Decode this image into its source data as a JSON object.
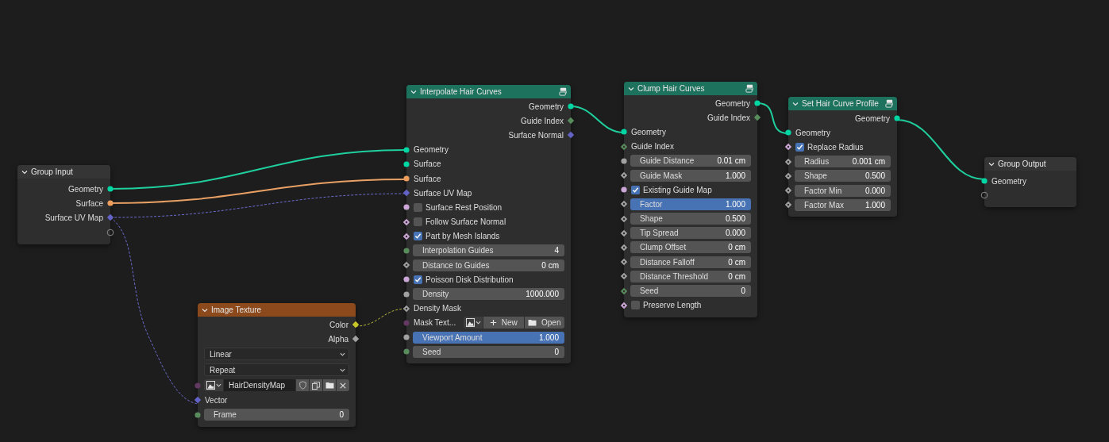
{
  "nodes": [
    {
      "title": "Group Input",
      "kind": "group",
      "rows": [
        {
          "kind": "output",
          "label": "Geometry",
          "socket": {
            "kind": "circle",
            "color": "#00d6a3"
          }
        },
        {
          "kind": "output",
          "label": "Surface",
          "socket": {
            "kind": "circle",
            "color": "#ed9e5c"
          }
        },
        {
          "kind": "output",
          "label": "Surface UV Map",
          "socket": {
            "kind": "diamond",
            "color": "#6363c7"
          }
        },
        {
          "kind": "output",
          "socket": {
            "kind": "empty"
          }
        }
      ]
    },
    {
      "title": "Image Texture",
      "kind": "texture",
      "rows": [
        {
          "kind": "output",
          "label": "Color",
          "socket": {
            "kind": "diamond",
            "color": "#c7c729"
          }
        },
        {
          "kind": "output",
          "label": "Alpha",
          "socket": {
            "kind": "diamond",
            "color": "#a1a1a1"
          }
        },
        {
          "kind": "dropdown",
          "value": "Linear"
        },
        {
          "kind": "dropdown",
          "value": "Repeat"
        },
        {
          "kind": "image_picker",
          "value": "HairDensityMap",
          "socket": {
            "kind": "circle",
            "color": "#633863"
          }
        },
        {
          "kind": "input",
          "label": "Vector",
          "socket": {
            "kind": "diamond",
            "color": "#6363c7"
          }
        },
        {
          "kind": "field",
          "label": "Frame",
          "value": "0",
          "selected": false,
          "socket": {
            "kind": "circle",
            "color": "#598c5c"
          }
        }
      ]
    },
    {
      "title": "Interpolate Hair Curves",
      "kind": "geometry",
      "rows": [
        {
          "kind": "output",
          "label": "Geometry",
          "socket": {
            "kind": "circle",
            "color": "#00d6a3"
          }
        },
        {
          "kind": "output",
          "label": "Guide Index",
          "socket": {
            "kind": "diamond",
            "color": "#598c5c"
          }
        },
        {
          "kind": "output",
          "label": "Surface Normal",
          "socket": {
            "kind": "diamond",
            "color": "#6363c7"
          }
        },
        {
          "kind": "input",
          "label": "Geometry",
          "socket": {
            "kind": "circle",
            "color": "#00d6a3"
          }
        },
        {
          "kind": "input",
          "label": "Surface",
          "socket": {
            "kind": "circle",
            "color": "#00d6a3"
          }
        },
        {
          "kind": "input",
          "label": "Surface",
          "socket": {
            "kind": "circle",
            "color": "#ed9e5c"
          }
        },
        {
          "kind": "input",
          "label": "Surface UV Map",
          "socket": {
            "kind": "diamond",
            "color": "#6363c7"
          }
        },
        {
          "kind": "checkbox",
          "label": "Surface Rest Position",
          "checked": false,
          "socket": {
            "kind": "circle",
            "color": "#cca6d6"
          }
        },
        {
          "kind": "checkbox",
          "label": "Follow Surface Normal",
          "checked": false,
          "socket": {
            "kind": "diamond_dot",
            "color": "#cca6d6"
          }
        },
        {
          "kind": "checkbox",
          "label": "Part by Mesh Islands",
          "checked": true,
          "socket": {
            "kind": "diamond_dot",
            "color": "#cca6d6"
          }
        },
        {
          "kind": "field",
          "label": "Interpolation Guides",
          "value": "4",
          "selected": false,
          "socket": {
            "kind": "circle",
            "color": "#598c5c"
          }
        },
        {
          "kind": "field",
          "label": "Distance to Guides",
          "value": "0 cm",
          "selected": false,
          "socket": {
            "kind": "diamond_dot",
            "color": "#a1a1a1"
          }
        },
        {
          "kind": "checkbox",
          "label": "Poisson Disk Distribution",
          "checked": true,
          "socket": {
            "kind": "circle",
            "color": "#cca6d6"
          }
        },
        {
          "kind": "field",
          "label": "Density",
          "value": "1000.000",
          "selected": false,
          "socket": {
            "kind": "circle",
            "color": "#a1a1a1"
          }
        },
        {
          "kind": "input",
          "label": "Density Mask",
          "socket": {
            "kind": "diamond_dot",
            "color": "#a1a1a1"
          }
        },
        {
          "kind": "texture_picker",
          "label": "Mask Text...",
          "buttons": [
            "New",
            "Open"
          ],
          "socket": {
            "kind": "circle",
            "color": "#633863"
          }
        },
        {
          "kind": "field",
          "label": "Viewport Amount",
          "value": "1.000",
          "selected": true,
          "socket": {
            "kind": "circle",
            "color": "#a1a1a1"
          }
        },
        {
          "kind": "field",
          "label": "Seed",
          "value": "0",
          "selected": false,
          "socket": {
            "kind": "circle",
            "color": "#598c5c"
          }
        }
      ]
    },
    {
      "title": "Clump Hair Curves",
      "kind": "geometry",
      "rows": [
        {
          "kind": "output",
          "label": "Geometry",
          "socket": {
            "kind": "circle",
            "color": "#00d6a3"
          }
        },
        {
          "kind": "output",
          "label": "Guide Index",
          "socket": {
            "kind": "diamond",
            "color": "#598c5c"
          }
        },
        {
          "kind": "input",
          "label": "Geometry",
          "socket": {
            "kind": "circle",
            "color": "#00d6a3"
          }
        },
        {
          "kind": "input",
          "label": "Guide Index",
          "socket": {
            "kind": "diamond_dot",
            "color": "#598c5c"
          }
        },
        {
          "kind": "field",
          "label": "Guide Distance",
          "value": "0.01 cm",
          "selected": false,
          "socket": {
            "kind": "circle",
            "color": "#a1a1a1"
          }
        },
        {
          "kind": "field",
          "label": "Guide Mask",
          "value": "1.000",
          "selected": false,
          "socket": {
            "kind": "diamond_dot",
            "color": "#a1a1a1"
          }
        },
        {
          "kind": "checkbox",
          "label": "Existing Guide Map",
          "checked": true,
          "socket": {
            "kind": "circle",
            "color": "#cca6d6"
          }
        },
        {
          "kind": "field",
          "label": "Factor",
          "value": "1.000",
          "selected": true,
          "socket": {
            "kind": "diamond_dot",
            "color": "#a1a1a1"
          }
        },
        {
          "kind": "field",
          "label": "Shape",
          "value": "0.500",
          "selected": false,
          "socket": {
            "kind": "diamond_dot",
            "color": "#a1a1a1"
          }
        },
        {
          "kind": "field",
          "label": "Tip Spread",
          "value": "0.000",
          "selected": false,
          "socket": {
            "kind": "diamond_dot",
            "color": "#a1a1a1"
          }
        },
        {
          "kind": "field",
          "label": "Clump Offset",
          "value": "0 cm",
          "selected": false,
          "socket": {
            "kind": "diamond_dot",
            "color": "#a1a1a1"
          }
        },
        {
          "kind": "field",
          "label": "Distance Falloff",
          "value": "0 cm",
          "selected": false,
          "socket": {
            "kind": "diamond_dot",
            "color": "#a1a1a1"
          }
        },
        {
          "kind": "field",
          "label": "Distance Threshold",
          "value": "0 cm",
          "selected": false,
          "socket": {
            "kind": "diamond_dot",
            "color": "#a1a1a1"
          }
        },
        {
          "kind": "field",
          "label": "Seed",
          "value": "0",
          "selected": false,
          "socket": {
            "kind": "diamond_dot",
            "color": "#598c5c"
          }
        },
        {
          "kind": "checkbox",
          "label": "Preserve Length",
          "checked": false,
          "socket": {
            "kind": "diamond_dot",
            "color": "#cca6d6"
          }
        }
      ]
    },
    {
      "title": "Set Hair Curve Profile",
      "kind": "geometry",
      "rows": [
        {
          "kind": "output",
          "label": "Geometry",
          "socket": {
            "kind": "circle",
            "color": "#00d6a3"
          }
        },
        {
          "kind": "input",
          "label": "Geometry",
          "socket": {
            "kind": "circle",
            "color": "#00d6a3"
          }
        },
        {
          "kind": "checkbox",
          "label": "Replace Radius",
          "checked": true,
          "socket": {
            "kind": "diamond_dot",
            "color": "#cca6d6"
          }
        },
        {
          "kind": "field",
          "label": "Radius",
          "value": "0.001 cm",
          "selected": false,
          "socket": {
            "kind": "diamond_dot",
            "color": "#a1a1a1"
          }
        },
        {
          "kind": "field",
          "label": "Shape",
          "value": "0.500",
          "selected": false,
          "socket": {
            "kind": "diamond_dot",
            "color": "#a1a1a1"
          }
        },
        {
          "kind": "field",
          "label": "Factor Min",
          "value": "0.000",
          "selected": false,
          "socket": {
            "kind": "diamond_dot",
            "color": "#a1a1a1"
          }
        },
        {
          "kind": "field",
          "label": "Factor Max",
          "value": "1.000",
          "selected": false,
          "socket": {
            "kind": "diamond_dot",
            "color": "#a1a1a1"
          }
        }
      ]
    },
    {
      "title": "Group Output",
      "kind": "group",
      "rows": [
        {
          "kind": "input",
          "label": "Geometry",
          "socket": {
            "kind": "circle",
            "color": "#00d6a3"
          }
        },
        {
          "kind": "input",
          "socket": {
            "kind": "empty"
          }
        }
      ]
    }
  ]
}
